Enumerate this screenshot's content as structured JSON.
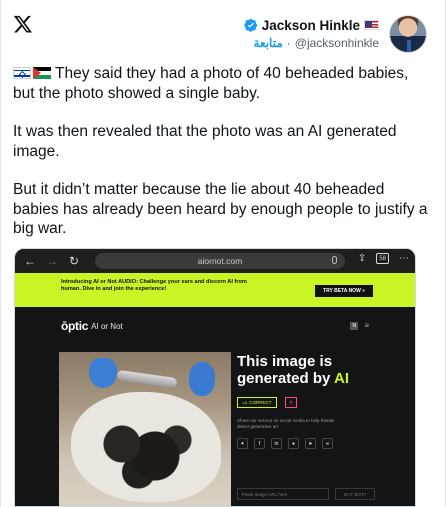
{
  "author": {
    "name": "Jackson Hinkle",
    "handle": "@jacksonhinkle",
    "follow_label": "متابعة",
    "separator": "·"
  },
  "tweet": {
    "paragraphs": [
      "They said they had a photo of 40 beheaded babies, but the photo showed a single baby.",
      "It was then revealed that the photo was an AI generated image.",
      "But it didn’t matter because the lie about 40 beheaded babies has already been heard by enough people to justify a big war."
    ]
  },
  "media": {
    "browser": {
      "url": "aiornot.com",
      "tabs_count": "58"
    },
    "banner": {
      "text": "Introducing AI or Not AUDIO: Challenge your ears and discern AI from human. Dive in and join the experience!",
      "button": "TRY BETA NOW  »"
    },
    "site": {
      "brand": "ōptic",
      "brand_sub": "AI or Not",
      "header_badge": "N",
      "result_title_prefix": "This image is generated by ",
      "result_title_ai": "AI",
      "correct_label": "CORRECT",
      "share_text": "Share our service on social media to help friends detect generative art",
      "url_placeholder": "Paste image URL here",
      "submit_label": "IS IT BOT?"
    }
  },
  "colors": {
    "accent_green": "#c8f523",
    "verified_blue": "#1d9bf0"
  }
}
